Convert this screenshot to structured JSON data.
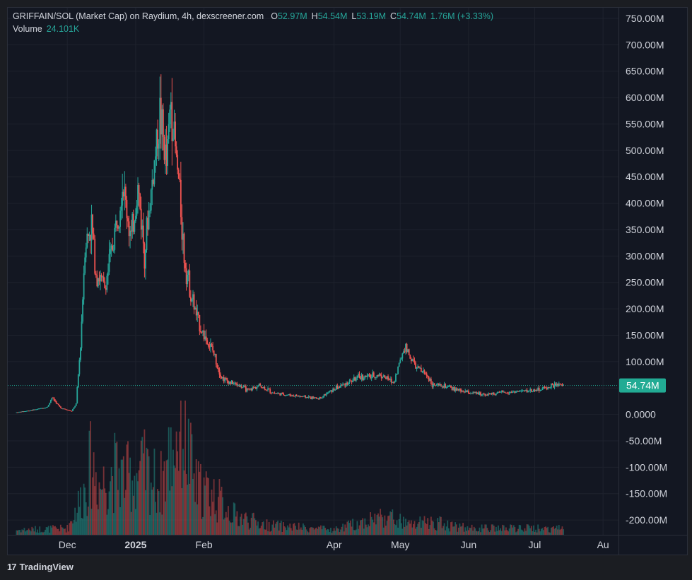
{
  "header": {
    "symbol": "GRIFFAIN/SOL (Market Cap) on Raydium, 4h, dexscreener.com",
    "o_label": "O",
    "o_value": "52.97M",
    "h_label": "H",
    "h_value": "54.54M",
    "l_label": "L",
    "l_value": "53.19M",
    "c_label": "C",
    "c_value": "54.74M",
    "change": "1.76M (+3.33%)",
    "volume_label": "Volume",
    "volume_value": "24.101K"
  },
  "footer": {
    "logo": "17",
    "brand": "TradingView"
  },
  "colors": {
    "up": "#26a69a",
    "down": "#ef5350",
    "grid": "#1e222d",
    "text": "#d1d4dc",
    "price_badge": "#22ab94"
  },
  "chart_data": {
    "type": "candlestick",
    "title": "GRIFFAIN/SOL (Market Cap) on Raydium, 4h, dexscreener.com",
    "interval": "4h",
    "price_axis": {
      "ticks": [
        "750.00M",
        "700.00M",
        "650.00M",
        "600.00M",
        "550.00M",
        "500.00M",
        "450.00M",
        "400.00M",
        "350.00M",
        "300.00M",
        "250.00M",
        "200.00M",
        "150.00M",
        "100.00M",
        "50.00M",
        "0.0000",
        "-50.00M",
        "-100.00M",
        "-150.00M",
        "-200.00M"
      ],
      "tick_values": [
        750,
        700,
        650,
        600,
        550,
        500,
        450,
        400,
        350,
        300,
        250,
        200,
        150,
        100,
        50,
        0,
        -50,
        -100,
        -150,
        -200
      ],
      "unit": "M",
      "ylim": [
        -228,
        770
      ]
    },
    "time_axis": {
      "labels": [
        "Dec",
        "2025",
        "Feb",
        "Apr",
        "May",
        "Jun",
        "Jul",
        "Au"
      ],
      "label_dates": [
        "2024-12-01",
        "2025-01-01",
        "2025-02-01",
        "2025-04-01",
        "2025-05-01",
        "2025-06-01",
        "2025-07-01",
        "2025-08-01"
      ],
      "bold": [
        false,
        true,
        false,
        false,
        false,
        false,
        false,
        false
      ],
      "range": [
        "2024-11-04",
        "2025-08-08"
      ]
    },
    "last_price": {
      "value": 54.74,
      "label": "54.74M"
    },
    "trend": {
      "dates": [
        "2024-11-08",
        "2024-11-15",
        "2024-11-22",
        "2024-11-24",
        "2024-11-28",
        "2024-12-03",
        "2024-12-05",
        "2024-12-07",
        "2024-12-09",
        "2024-12-12",
        "2024-12-14",
        "2024-12-18",
        "2024-12-22",
        "2024-12-26",
        "2024-12-30",
        "2025-01-02",
        "2025-01-05",
        "2025-01-08",
        "2025-01-12",
        "2025-01-15",
        "2025-01-17",
        "2025-01-19",
        "2025-01-21",
        "2025-01-23",
        "2025-01-26",
        "2025-01-29",
        "2025-02-01",
        "2025-02-05",
        "2025-02-09",
        "2025-02-13",
        "2025-02-17",
        "2025-02-21",
        "2025-02-26",
        "2025-03-05",
        "2025-03-15",
        "2025-03-25",
        "2025-04-02",
        "2025-04-12",
        "2025-04-18",
        "2025-04-22",
        "2025-04-28",
        "2025-05-03",
        "2025-05-08",
        "2025-05-13",
        "2025-05-16",
        "2025-05-22",
        "2025-05-28",
        "2025-06-03",
        "2025-06-10",
        "2025-06-18",
        "2025-06-25",
        "2025-07-01",
        "2025-07-06",
        "2025-07-10",
        "2025-07-14"
      ],
      "values": [
        4,
        8,
        14,
        32,
        12,
        6,
        20,
        130,
        320,
        360,
        270,
        240,
        330,
        440,
        330,
        430,
        310,
        420,
        570,
        470,
        600,
        500,
        420,
        300,
        230,
        180,
        150,
        120,
        70,
        60,
        55,
        45,
        55,
        40,
        35,
        30,
        50,
        70,
        72,
        75,
        60,
        130,
        90,
        75,
        55,
        52,
        45,
        40,
        38,
        42,
        44,
        46,
        50,
        55,
        55
      ]
    },
    "volume": {
      "dates": [
        "2024-11-08",
        "2024-12-01",
        "2024-12-08",
        "2024-12-12",
        "2024-12-16",
        "2024-12-22",
        "2024-12-28",
        "2025-01-05",
        "2025-01-12",
        "2025-01-18",
        "2025-01-22",
        "2025-01-28",
        "2025-02-05",
        "2025-02-15",
        "2025-03-01",
        "2025-04-01",
        "2025-04-24",
        "2025-05-05",
        "2025-05-16",
        "2025-06-01",
        "2025-07-14"
      ],
      "values": [
        3,
        4,
        25,
        45,
        30,
        40,
        35,
        40,
        30,
        55,
        70,
        30,
        25,
        12,
        6,
        3,
        12,
        6,
        8,
        4,
        4
      ],
      "unit": "relative"
    }
  }
}
